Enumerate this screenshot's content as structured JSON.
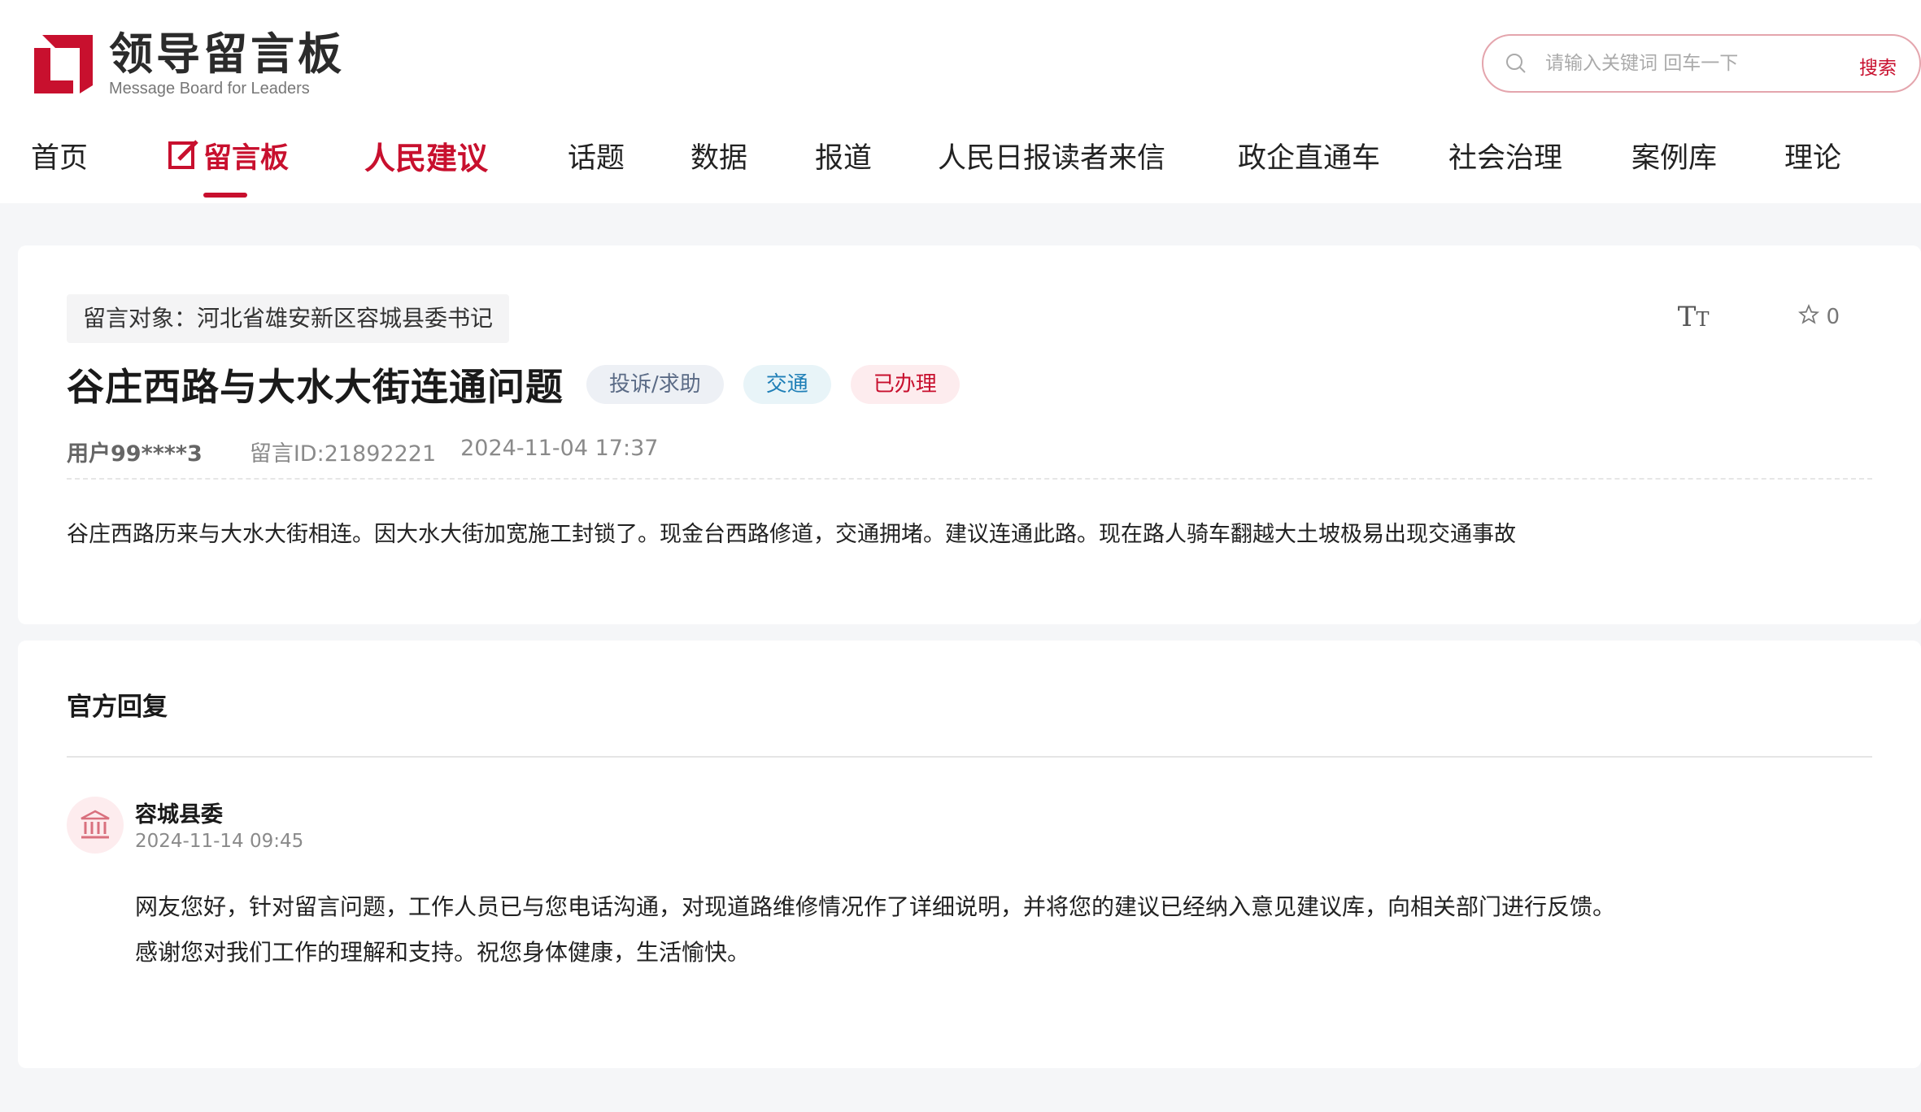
{
  "site": {
    "logo_cn": "领导留言板",
    "logo_en": "Message Board for Leaders",
    "brand_color": "#c8102e"
  },
  "search": {
    "placeholder": "请输入关键词 回车一下",
    "button_label": "搜索"
  },
  "nav": {
    "items": [
      {
        "label": "首页"
      },
      {
        "label": "留言板",
        "active": true
      },
      {
        "label": "人民建议"
      },
      {
        "label": "话题"
      },
      {
        "label": "数据"
      },
      {
        "label": "报道"
      },
      {
        "label": "人民日报读者来信"
      },
      {
        "label": "政企直通车"
      },
      {
        "label": "社会治理"
      },
      {
        "label": "案例库"
      },
      {
        "label": "理论"
      }
    ]
  },
  "message": {
    "target": "留言对象：河北省雄安新区容城县委书记",
    "title": "谷庄西路与大水大街连通问题",
    "tags": [
      "投诉/求助",
      "交通",
      "已办理"
    ],
    "user": "用户99****3",
    "message_id": "留言ID:21892221",
    "time": "2024-11-04 17:37",
    "favorites": "0",
    "font_size_icon": "text-size-icon",
    "content": "谷庄西路历来与大水大街相连。因大水大街加宽施工封锁了。现金台西路修道，交通拥堵。建议连通此路。现在路人骑车翻越大土坡极易出现交通事故"
  },
  "reply": {
    "heading": "官方回复",
    "org": "容城县委",
    "time": "2024-11-14 09:45",
    "lines": [
      "网友您好，针对留言问题，工作人员已与您电话沟通，对现道路维修情况作了详细说明，并将您的建议已经纳入意见建议库，向相关部门进行反馈。",
      "感谢您对我们工作的理解和支持。祝您身体健康，生活愉快。"
    ]
  }
}
